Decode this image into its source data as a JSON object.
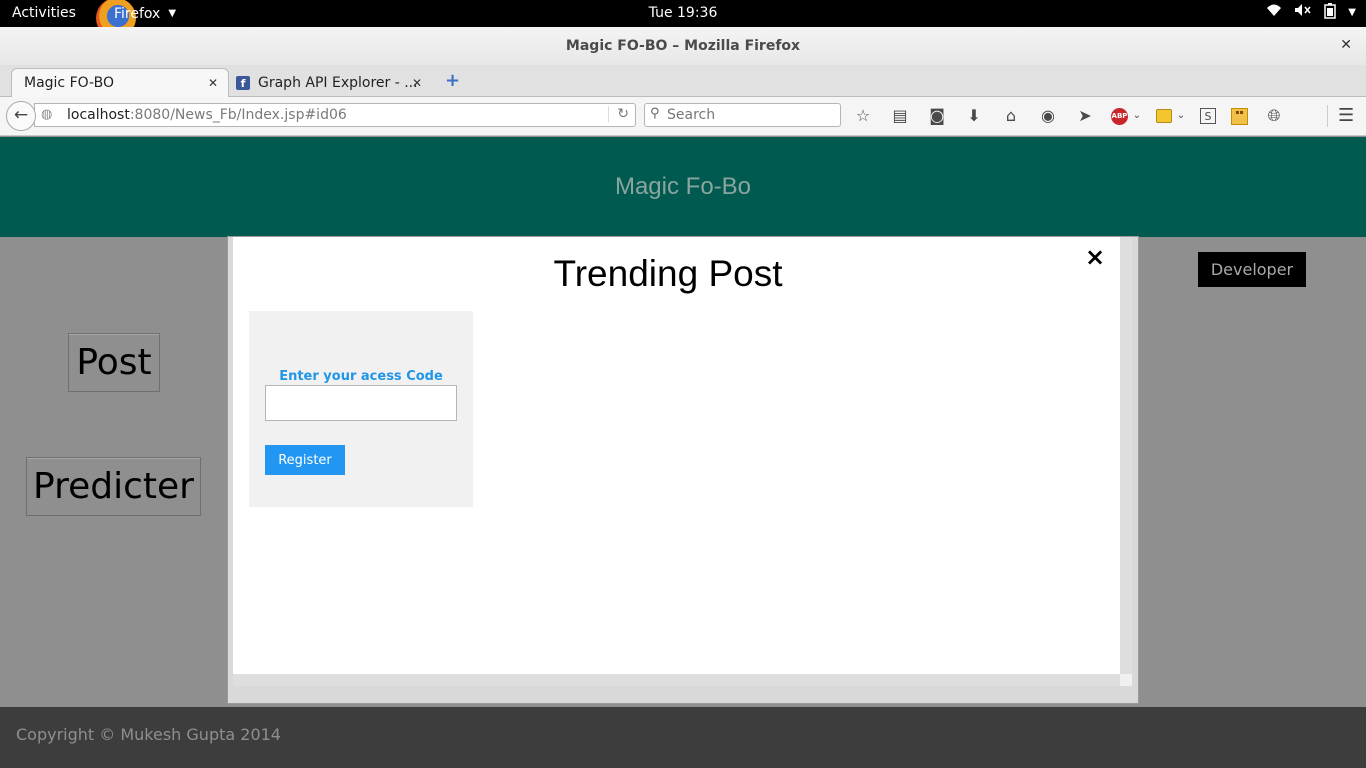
{
  "os_topbar": {
    "activities": "Activities",
    "app_name": "Firefox",
    "clock": "Tue 19:36"
  },
  "browser": {
    "window_title": "Magic FO-BO – Mozilla Firefox",
    "tabs": [
      {
        "label": "Magic FO-BO",
        "active": true
      },
      {
        "label": "Graph API Explorer - ...",
        "active": false,
        "icon": "facebook-icon"
      }
    ],
    "url_host": "localhost",
    "url_rest": ":8080/News_Fb/Index.jsp#id06",
    "search_placeholder": "Search",
    "abp_label": "ABP"
  },
  "page": {
    "header_title": "Magic Fo-Bo",
    "side_buttons": {
      "post": "Post",
      "predicter": "Predicter"
    },
    "developer_button": "Developer",
    "footer": "Copyright © Mukesh Gupta 2014"
  },
  "modal": {
    "title": "Trending Post",
    "close": "×",
    "access_label": "Enter your acess Code",
    "access_value": "",
    "register_label": "Register"
  }
}
